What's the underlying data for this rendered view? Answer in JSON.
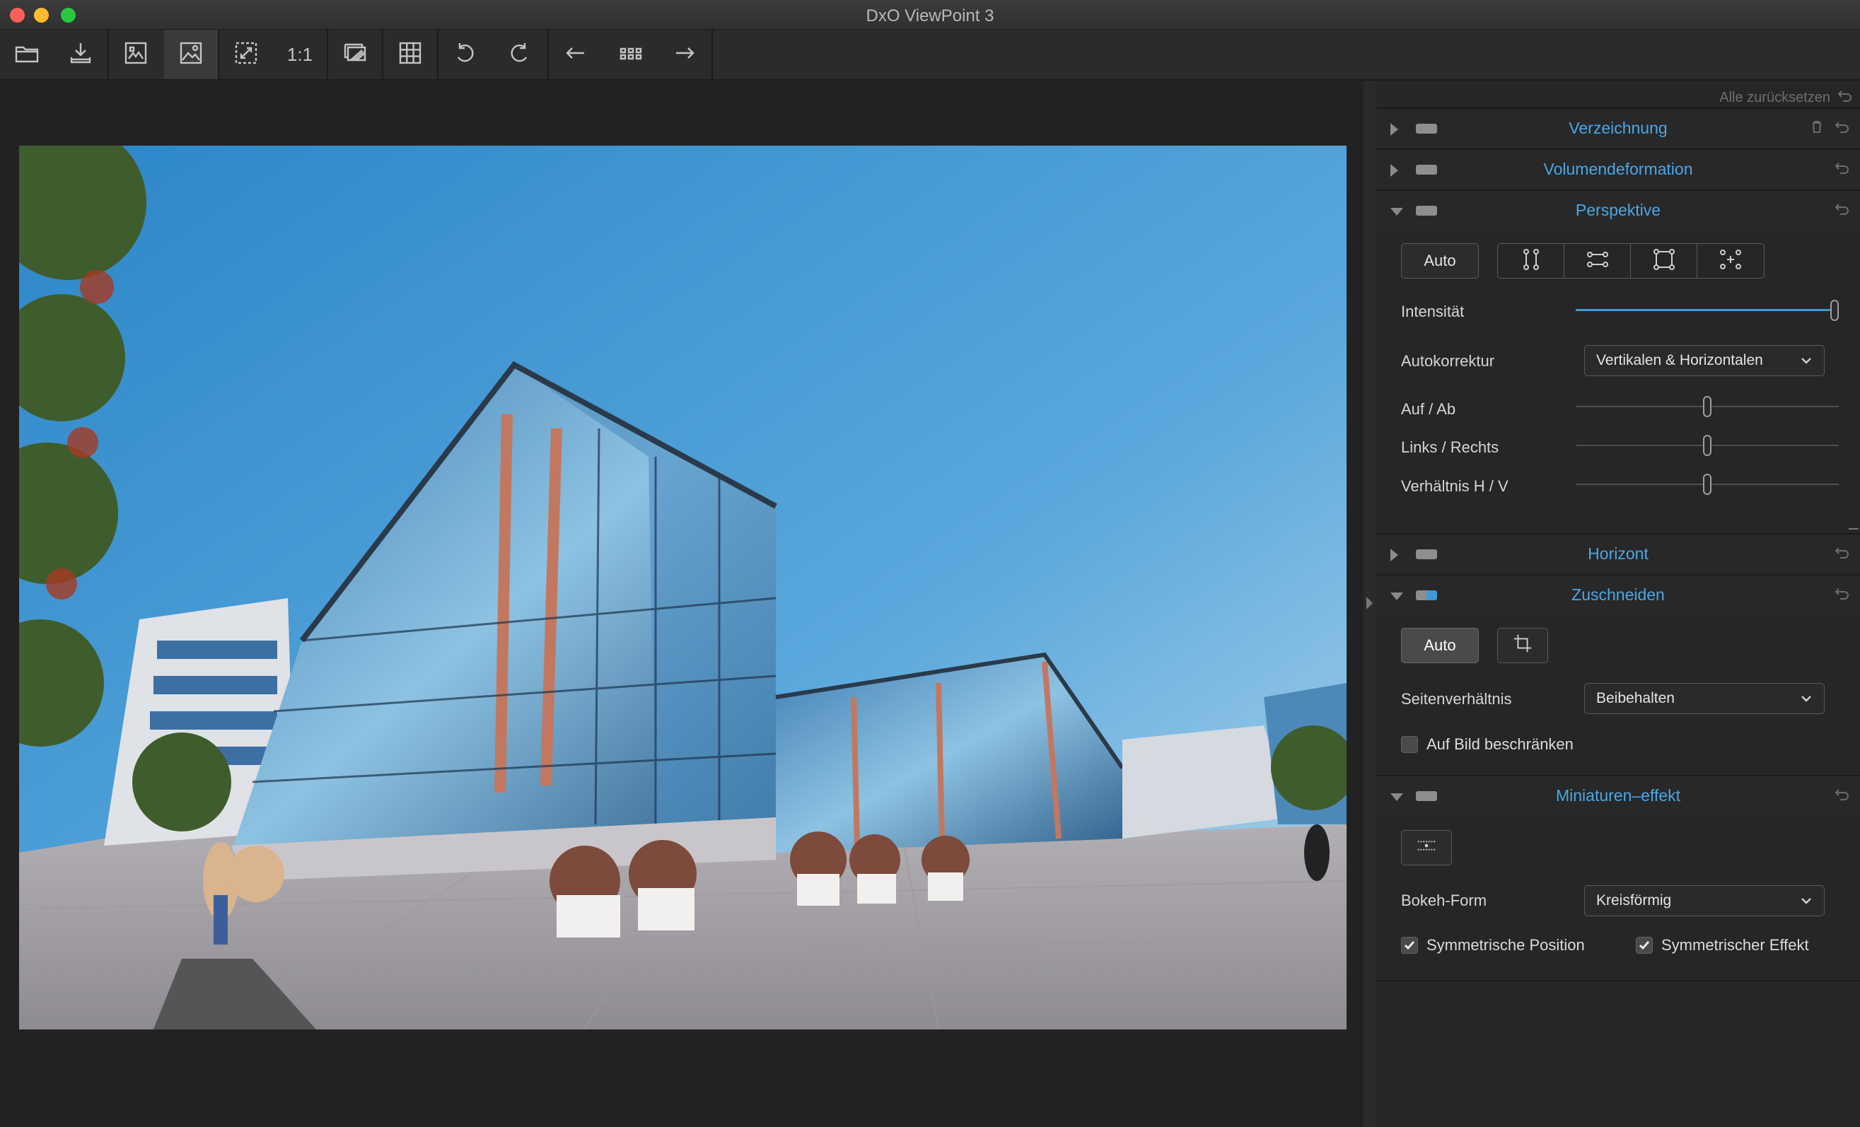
{
  "window": {
    "title": "DxO ViewPoint 3"
  },
  "toolbar": {
    "buttons": [
      {
        "name": "open-folder-button",
        "icon": "folder-icon"
      },
      {
        "name": "export-button",
        "icon": "download-icon"
      },
      {
        "name": "before-after-button",
        "icon": "compare-image-icon"
      },
      {
        "name": "image-view-button",
        "icon": "image-icon",
        "active": true
      },
      {
        "name": "fit-screen-button",
        "icon": "fit-icon"
      },
      {
        "name": "actual-size-button",
        "label": "1:1"
      },
      {
        "name": "overlay-button",
        "icon": "overlay-icon"
      },
      {
        "name": "grid-button",
        "icon": "grid-icon"
      },
      {
        "name": "rotate-left-button",
        "icon": "rotate-left-icon"
      },
      {
        "name": "rotate-right-button",
        "icon": "rotate-right-icon"
      },
      {
        "name": "previous-button",
        "icon": "arrow-left-icon"
      },
      {
        "name": "browser-button",
        "icon": "thumbnails-icon"
      },
      {
        "name": "next-button",
        "icon": "arrow-right-icon"
      }
    ],
    "one_to_one": "1:1"
  },
  "panel": {
    "reset_all": "Alle zurücksetzen",
    "sections": {
      "verzeichnung": "Verzeichnung",
      "volumendeformation": "Volumendeformation",
      "perspektive": "Perspektive",
      "horizont": "Horizont",
      "zuschneiden": "Zuschneiden",
      "miniaturen": "Miniaturen–effekt"
    },
    "perspektive": {
      "auto_label": "Auto",
      "intensitaet_label": "Intensität",
      "intensitaet_value": 1.0,
      "autokorrektur_label": "Autokorrektur",
      "autokorrektur_value": "Vertikalen & Horizontalen",
      "auf_ab_label": "Auf / Ab",
      "auf_ab_value": 0.5,
      "links_rechts_label": "Links / Rechts",
      "links_rechts_value": 0.5,
      "verhaeltnis_label": "Verhältnis H / V",
      "verhaeltnis_value": 0.5
    },
    "zuschneiden": {
      "auto_label": "Auto",
      "seitenverhaeltnis_label": "Seitenverhältnis",
      "seitenverhaeltnis_value": "Beibehalten",
      "auf_bild_label": "Auf Bild beschränken",
      "auf_bild_checked": false
    },
    "miniaturen": {
      "bokeh_label": "Bokeh-Form",
      "bokeh_value": "Kreisförmig",
      "sym_position_label": "Symmetrische Position",
      "sym_position_checked": true,
      "sym_effekt_label": "Symmetrischer Effekt",
      "sym_effekt_checked": true
    }
  },
  "colors": {
    "accent": "#3e9ad6",
    "section_title": "#4aa7e6"
  }
}
